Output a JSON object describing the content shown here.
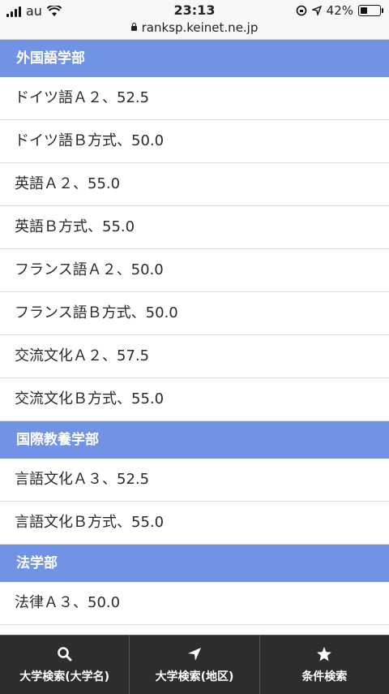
{
  "status_bar": {
    "carrier": "au",
    "time": "23:13",
    "battery": "42%",
    "battery_level": 0.42,
    "url": "ranksp.keinet.ne.jp"
  },
  "sections": [
    {
      "title": "外国語学部",
      "items": [
        "ドイツ語Ａ２、52.5",
        "ドイツ語Ｂ方式、50.0",
        "英語Ａ２、55.0",
        "英語Ｂ方式、55.0",
        "フランス語Ａ２、50.0",
        "フランス語Ｂ方式、50.0",
        "交流文化Ａ２、57.5",
        "交流文化Ｂ方式、55.0"
      ]
    },
    {
      "title": "国際教養学部",
      "items": [
        "言語文化Ａ３、52.5",
        "言語文化Ｂ方式、55.0"
      ]
    },
    {
      "title": "法学部",
      "items": [
        "法律Ａ３、50.0"
      ]
    }
  ],
  "tabbar": {
    "tabs": [
      {
        "icon": "search-icon",
        "label": "大学検索(大学名)"
      },
      {
        "icon": "location-arrow-icon",
        "label": "大学検索(地区)"
      },
      {
        "icon": "star-icon",
        "label": "条件検索"
      }
    ]
  }
}
